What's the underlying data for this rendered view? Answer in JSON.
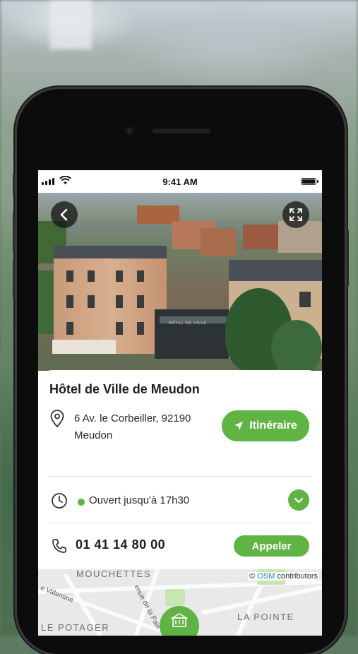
{
  "status_bar": {
    "time": "9:41 AM"
  },
  "place": {
    "name": "Hôtel de Ville de Meudon",
    "address_line1": "6 Av. le Corbeiller, 92190",
    "address_line2": "Meudon",
    "hours_status": "Ouvert jusqu'à 17h30",
    "phone": "01 41 14 80 00",
    "photo_sign": "HÔTEL DE VILLE"
  },
  "actions": {
    "directions_label": "Itinéraire",
    "call_label": "Appeler"
  },
  "map": {
    "labels": [
      "MOUCHETTES",
      "LE POTAGER",
      "LA POINTE"
    ],
    "streets": [
      "e Valentine",
      "enue de la Paix"
    ],
    "attribution_prefix": "©",
    "attribution_link": "OSM",
    "attribution_suffix": " contributors"
  },
  "colors": {
    "accent": "#5fb443",
    "osm_link": "#2f7fd3"
  },
  "icons": [
    "back-arrow-icon",
    "fullscreen-icon",
    "location-pin-icon",
    "navigation-arrow-icon",
    "clock-icon",
    "chevron-down-icon",
    "phone-icon",
    "town-hall-icon"
  ]
}
